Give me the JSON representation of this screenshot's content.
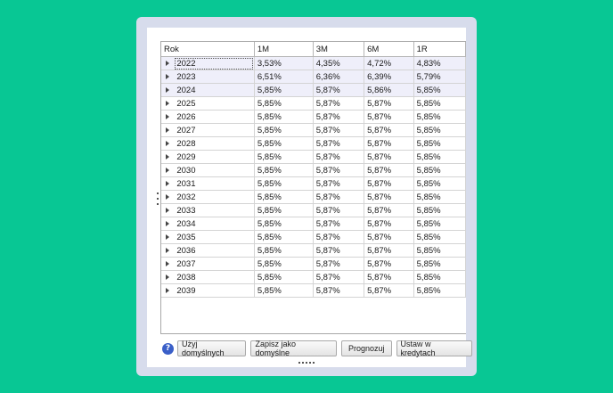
{
  "grid": {
    "columns": [
      "Rok",
      "1M",
      "3M",
      "6M",
      "1R"
    ],
    "rows": [
      [
        "2022",
        "3,53%",
        "4,35%",
        "4,72%",
        "4,83%"
      ],
      [
        "2023",
        "6,51%",
        "6,36%",
        "6,39%",
        "5,79%"
      ],
      [
        "2024",
        "5,85%",
        "5,87%",
        "5,86%",
        "5,85%"
      ],
      [
        "2025",
        "5,85%",
        "5,87%",
        "5,87%",
        "5,85%"
      ],
      [
        "2026",
        "5,85%",
        "5,87%",
        "5,87%",
        "5,85%"
      ],
      [
        "2027",
        "5,85%",
        "5,87%",
        "5,87%",
        "5,85%"
      ],
      [
        "2028",
        "5,85%",
        "5,87%",
        "5,87%",
        "5,85%"
      ],
      [
        "2029",
        "5,85%",
        "5,87%",
        "5,87%",
        "5,85%"
      ],
      [
        "2030",
        "5,85%",
        "5,87%",
        "5,87%",
        "5,85%"
      ],
      [
        "2031",
        "5,85%",
        "5,87%",
        "5,87%",
        "5,85%"
      ],
      [
        "2032",
        "5,85%",
        "5,87%",
        "5,87%",
        "5,85%"
      ],
      [
        "2033",
        "5,85%",
        "5,87%",
        "5,87%",
        "5,85%"
      ],
      [
        "2034",
        "5,85%",
        "5,87%",
        "5,87%",
        "5,85%"
      ],
      [
        "2035",
        "5,85%",
        "5,87%",
        "5,87%",
        "5,85%"
      ],
      [
        "2036",
        "5,85%",
        "5,87%",
        "5,87%",
        "5,85%"
      ],
      [
        "2037",
        "5,85%",
        "5,87%",
        "5,87%",
        "5,85%"
      ],
      [
        "2038",
        "5,85%",
        "5,87%",
        "5,87%",
        "5,85%"
      ],
      [
        "2039",
        "5,85%",
        "5,87%",
        "5,87%",
        "5,85%"
      ]
    ]
  },
  "toolbar": {
    "help_label": "?",
    "use_defaults": "Użyj domyślnych",
    "save_defaults": "Zapisz jako domyślne",
    "forecast": "Prognozuj",
    "apply_loans": "Ustaw w kredytach"
  },
  "colors": {
    "background": "#08c794",
    "window": "#d7dcec",
    "row_highlight": "#efeffa",
    "help_icon": "#3a5fc8"
  },
  "icons": {
    "row_expander": "triangle-right-icon",
    "help": "help-icon",
    "grip": "grip-dots-icon"
  }
}
